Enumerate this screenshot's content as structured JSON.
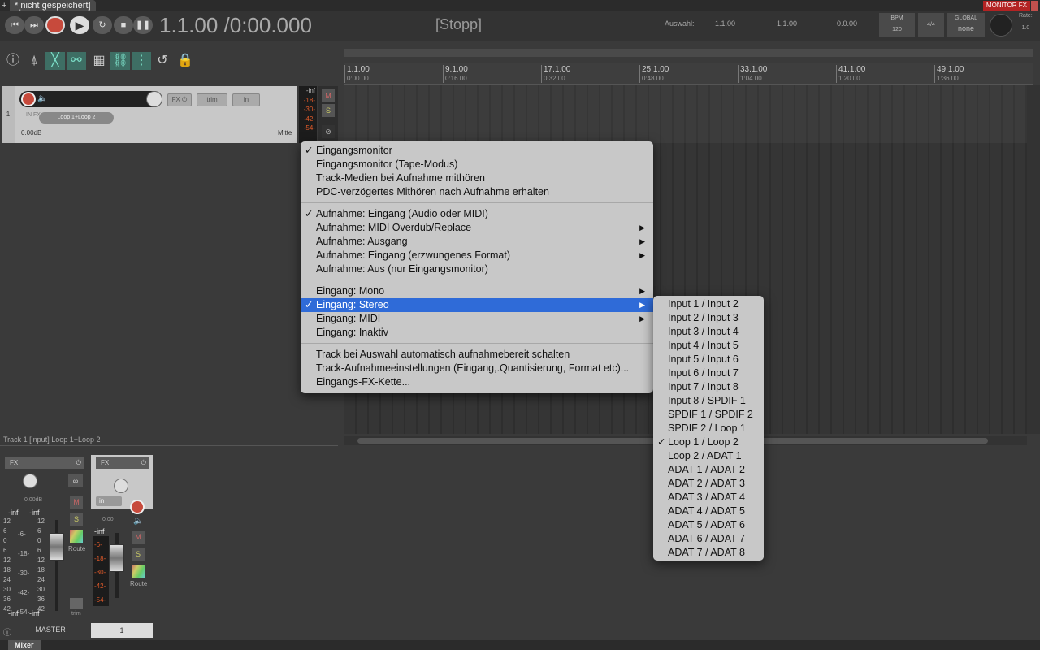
{
  "tabs": {
    "project_tab": "*[nicht gespeichert]",
    "monitor_fx": "MONITOR FX",
    "mixer_tab": "Mixer"
  },
  "transport": {
    "timecode": "1.1.00 /0:00.000",
    "status": "[Stopp]",
    "selection_label": "Auswahl:",
    "sel_start": "1.1.00",
    "sel_end": "1.1.00",
    "sel_length": "0.0.00",
    "bpm_label": "BPM",
    "bpm_value": "120",
    "time_sig": "4/4",
    "global_label": "GLOBAL",
    "global_value": "none",
    "rate_label": "Rate:",
    "rate_value": "1.0"
  },
  "ruler": [
    {
      "bar": "1.1.00",
      "time": "0:00.00"
    },
    {
      "bar": "9.1.00",
      "time": "0:16.00"
    },
    {
      "bar": "17.1.00",
      "time": "0:32.00"
    },
    {
      "bar": "25.1.00",
      "time": "0:48.00"
    },
    {
      "bar": "33.1.00",
      "time": "1:04.00"
    },
    {
      "bar": "41.1.00",
      "time": "1:20.00"
    },
    {
      "bar": "49.1.00",
      "time": "1:36.00"
    }
  ],
  "track": {
    "number": "1",
    "fx": "FX",
    "trim": "trim",
    "in": "in",
    "in_fx": "IN FX",
    "input": "Loop 1+Loop 2",
    "volume": "0.00dB",
    "pan": "Mitte",
    "meter_labels": [
      "-inf",
      "-18-",
      "-30-",
      "-42-",
      "-54-"
    ],
    "mute": "M",
    "solo": "S"
  },
  "mixer": {
    "info": "Track 1 [input] Loop 1+Loop 2",
    "master_fx": "FX",
    "master_db": "0.00dB",
    "master_peak_l": "-inf",
    "master_peak_r": "-inf",
    "master_scale": [
      "12",
      "6",
      "0",
      "6",
      "12",
      "18",
      "24",
      "30",
      "36",
      "42"
    ],
    "master_scale_right": [
      "12",
      "6",
      "0",
      "6",
      "12",
      "18",
      "24",
      "30",
      "36",
      "42"
    ],
    "master_scale_mid": [
      "-6-",
      "-18-",
      "-30-",
      "-42-",
      "-54-"
    ],
    "master_bottom_l": "-inf",
    "master_bottom_r": "-inf",
    "master_label": "MASTER",
    "route": "Route",
    "trim": "trim",
    "track_fx": "FX",
    "track_in": "in",
    "track_db": "0.00",
    "track_peak": "-inf",
    "track_scale": [
      "-6-",
      "-18-",
      "-30-",
      "-42-",
      "-54-"
    ],
    "track_label": "1",
    "mute": "M",
    "solo": "S"
  },
  "menu": {
    "group1": [
      {
        "label": "Eingangsmonitor",
        "checked": "✓"
      },
      {
        "label": "Eingangsmonitor (Tape-Modus)",
        "checked": ""
      },
      {
        "label": "Track-Medien bei Aufnahme mithören",
        "checked": ""
      },
      {
        "label": "PDC-verzögertes Mithören nach Aufnahme erhalten",
        "checked": ""
      }
    ],
    "group2": [
      {
        "label": "Aufnahme: Eingang (Audio oder MIDI)",
        "checked": "✓",
        "arrow": ""
      },
      {
        "label": "Aufnahme: MIDI Overdub/Replace",
        "checked": "",
        "arrow": "▶"
      },
      {
        "label": "Aufnahme: Ausgang",
        "checked": "",
        "arrow": "▶"
      },
      {
        "label": "Aufnahme: Eingang (erzwungenes Format)",
        "checked": "",
        "arrow": "▶"
      },
      {
        "label": "Aufnahme: Aus (nur Eingangsmonitor)",
        "checked": "",
        "arrow": ""
      }
    ],
    "group3": [
      {
        "label": "Eingang: Mono",
        "checked": "",
        "arrow": "▶"
      },
      {
        "label": "Eingang: Stereo",
        "checked": "✓",
        "arrow": "▶"
      },
      {
        "label": "Eingang: MIDI",
        "checked": "",
        "arrow": "▶"
      },
      {
        "label": "Eingang: Inaktiv",
        "checked": "",
        "arrow": ""
      }
    ],
    "group4": [
      {
        "label": "Track bei Auswahl automatisch aufnahmebereit schalten"
      },
      {
        "label": "Track-Aufnahmeeinstellungen (Eingang,.Quantisierung, Format etc)..."
      },
      {
        "label": "Eingangs-FX-Kette..."
      }
    ]
  },
  "submenu": [
    {
      "label": "Input 1 / Input 2",
      "checked": ""
    },
    {
      "label": "Input 2 / Input 3",
      "checked": ""
    },
    {
      "label": "Input 3 / Input 4",
      "checked": ""
    },
    {
      "label": "Input 4 / Input 5",
      "checked": ""
    },
    {
      "label": "Input 5 / Input 6",
      "checked": ""
    },
    {
      "label": "Input 6 / Input 7",
      "checked": ""
    },
    {
      "label": "Input 7 / Input 8",
      "checked": ""
    },
    {
      "label": "Input 8 / SPDIF 1",
      "checked": ""
    },
    {
      "label": "SPDIF 1 / SPDIF 2",
      "checked": ""
    },
    {
      "label": "SPDIF 2 / Loop 1",
      "checked": ""
    },
    {
      "label": "Loop 1 / Loop 2",
      "checked": "✓"
    },
    {
      "label": "Loop 2 / ADAT 1",
      "checked": ""
    },
    {
      "label": "ADAT 1 / ADAT 2",
      "checked": ""
    },
    {
      "label": "ADAT 2 / ADAT 3",
      "checked": ""
    },
    {
      "label": "ADAT 3 / ADAT 4",
      "checked": ""
    },
    {
      "label": "ADAT 4 / ADAT 5",
      "checked": ""
    },
    {
      "label": "ADAT 5 / ADAT 6",
      "checked": ""
    },
    {
      "label": "ADAT 6 / ADAT 7",
      "checked": ""
    },
    {
      "label": "ADAT 7 / ADAT 8",
      "checked": ""
    }
  ],
  "colors": {
    "accent": "#2f6bd8",
    "record": "#c74a3c",
    "active_tool": "#3e6e64"
  }
}
